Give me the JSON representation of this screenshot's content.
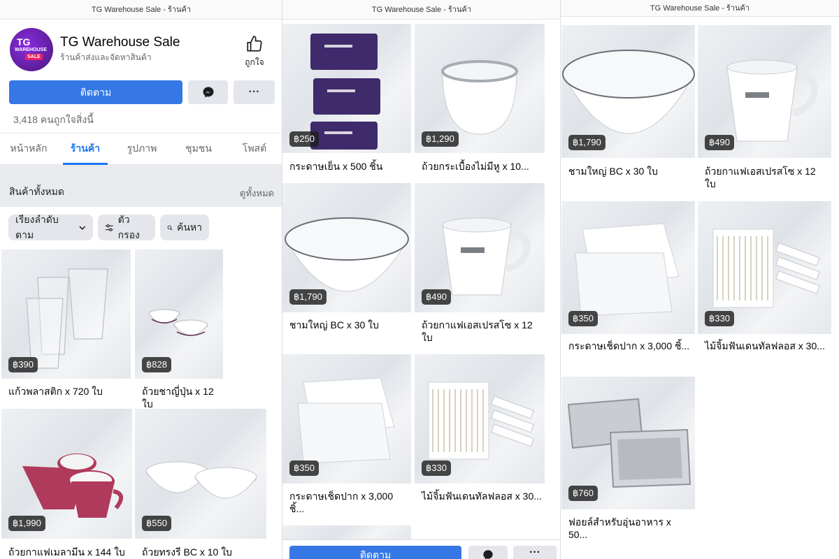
{
  "window_title": "TG Warehouse Sale - ร้านค้า",
  "page": {
    "name": "TG Warehouse Sale",
    "subtitle": "ร้านค้าส่งและจัดหาสินค้า",
    "avatar": {
      "line1": "TG",
      "line2": "WAREHOUSE",
      "line3": "SALE"
    },
    "like_label": "ถูกใจ",
    "follow_label": "ติดตาม",
    "more_label": "···",
    "likes_count": "3,418 คนถูกใจสิ่งนี้"
  },
  "tabs": [
    {
      "label": "หน้าหลัก",
      "active": false
    },
    {
      "label": "ร้านค้า",
      "active": true
    },
    {
      "label": "รูปภาพ",
      "active": false
    },
    {
      "label": "ชุมชน",
      "active": false
    },
    {
      "label": "โพสต์",
      "active": false
    }
  ],
  "shop": {
    "all_products": "สินค้าทั้งหมด",
    "view_all": "ดูทั้งหมด",
    "sort_label": "เรียงลำดับตาม",
    "filter_label": "ตัวกรอง",
    "search_label": "ค้นหา"
  },
  "panel1_products": [
    {
      "price": "฿390",
      "name": "แก้วพลาสติก x 720 ใบ",
      "image": "plastic-cups"
    },
    {
      "price": "฿828",
      "name": "ถ้วยชาญี่ปุ่น x 12 ใบ",
      "image": "tea-cups"
    },
    {
      "price": "฿1,990",
      "name": "ถ้วยกาแฟเมลามีน x 144 ใบ",
      "image": "melamine-mugs"
    },
    {
      "price": "฿550",
      "name": "ถ้วยทรงรี BC x 10 ใบ",
      "image": "oval-bowls"
    }
  ],
  "panel2_products": [
    {
      "price": "฿250",
      "name": "กระดาษเย็น x 500 ชิ้น",
      "image": "tissue-packs"
    },
    {
      "price": "฿1,290",
      "name": "ถ้วยกระเบื้องไม่มีหู x 10...",
      "image": "porcelain-cup"
    },
    {
      "price": "฿1,790",
      "name": "ชามใหญ่ BC x 30 ใบ",
      "image": "large-bowl"
    },
    {
      "price": "฿490",
      "name": "ถ้วยกาแฟเอสเปรสโซ x 12 ใบ",
      "image": "espresso-cup"
    },
    {
      "price": "฿350",
      "name": "กระดาษเช็ดปาก x 3,000 ชิ้...",
      "image": "napkins"
    },
    {
      "price": "฿330",
      "name": "ไม้จิ้มฟันเดนทัลฟลอส x 30...",
      "image": "toothpicks"
    }
  ],
  "panel3_products": [
    {
      "price": "฿1,790",
      "name": "ชามใหญ่ BC x 30 ใบ",
      "image": "large-bowl"
    },
    {
      "price": "฿490",
      "name": "ถ้วยกาแฟเอสเปรสโซ x 12 ใบ",
      "image": "espresso-cup"
    },
    {
      "price": "฿350",
      "name": "กระดาษเช็ดปาก x 3,000 ชิ้...",
      "image": "napkins"
    },
    {
      "price": "฿330",
      "name": "ไม้จิ้มฟันเดนทัลฟลอส x 30...",
      "image": "toothpicks"
    },
    {
      "price": "฿760",
      "name": "ฟอยล์สำหรับอุ่นอาหาร x 50...",
      "image": "foil-trays"
    }
  ],
  "colors": {
    "accent": "#1877f2",
    "button_blue": "#3578e5",
    "button_grey": "#e4e6eb",
    "price_badge": "#1e1e1e"
  }
}
